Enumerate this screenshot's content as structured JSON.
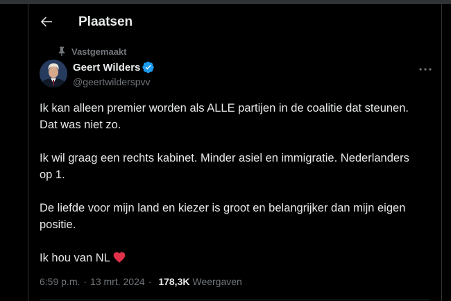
{
  "header": {
    "title": "Plaatsen"
  },
  "pinned": {
    "label": "Vastgemaakt"
  },
  "author": {
    "name": "Geert Wilders",
    "handle": "@geertwilderspvv"
  },
  "tweet": {
    "line1": "Ik kan alleen premier worden als ALLE partijen in de coalitie dat steunen.",
    "line2": "Dat was niet zo.",
    "para2_line1": "Ik wil graag een rechts kabinet. Minder asiel en immigratie. Nederlanders",
    "para2_line2": "op 1.",
    "para3_line1": "De liefde voor mijn land en kiezer is groot en belangrijker dan mijn eigen",
    "para3_line2": "positie.",
    "para4": "Ik hou van NL"
  },
  "meta": {
    "time": "6:59 p.m.",
    "separator": "·",
    "date": "13 mrt. 2024",
    "views_count": "178,3K",
    "views_label": "Weergaven"
  },
  "colors": {
    "background": "#000000",
    "text": "#e7e9ea",
    "muted": "#71767b",
    "verified": "#1d9bf0",
    "heart": "#f91880"
  },
  "icons": [
    "back-arrow-icon",
    "pin-icon",
    "verified-badge-icon",
    "more-icon",
    "heart-emoji-icon"
  ]
}
